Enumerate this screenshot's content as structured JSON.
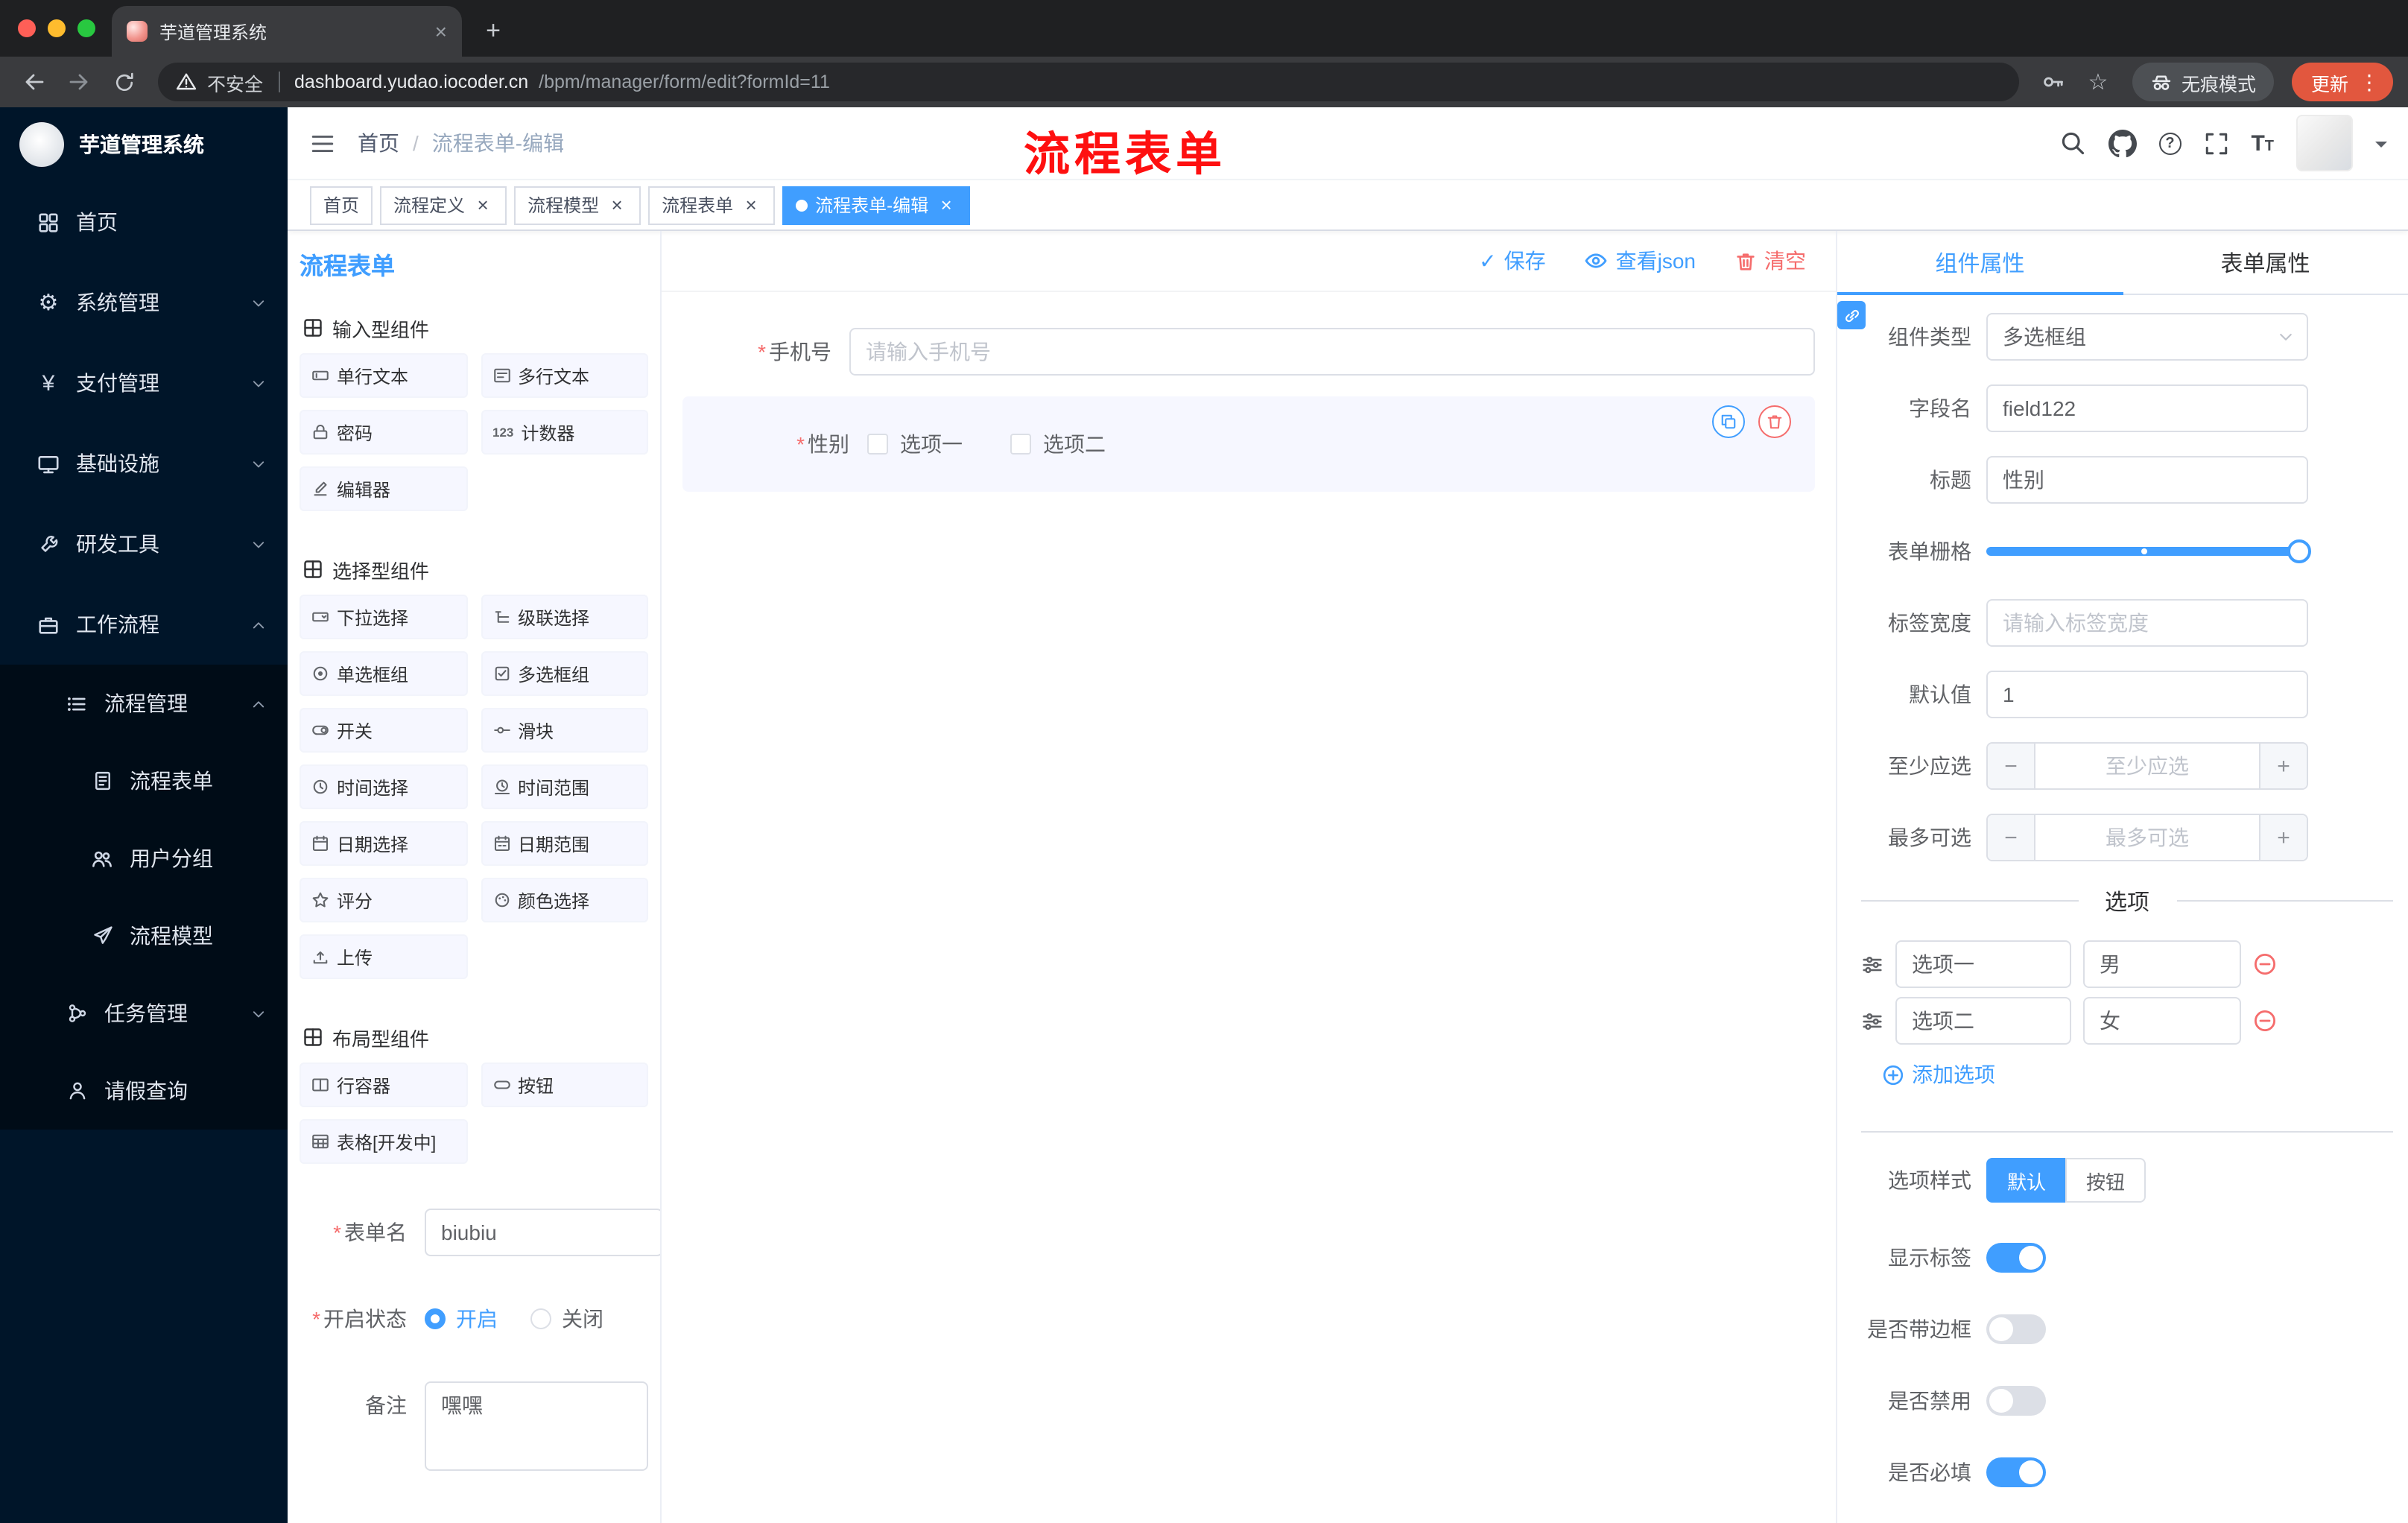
{
  "browser": {
    "tab_title": "芋道管理系统",
    "security_label": "不安全",
    "url_host": "dashboard.yudao.iocoder.cn",
    "url_path": "/bpm/manager/form/edit?formId=11",
    "incognito_label": "无痕模式",
    "update_label": "更新"
  },
  "sidebar": {
    "logo_title": "芋道管理系统",
    "home": "首页",
    "system": "系统管理",
    "payment": "支付管理",
    "infra": "基础设施",
    "devtools": "研发工具",
    "workflow": "工作流程",
    "process_mgmt": "流程管理",
    "process_form": "流程表单",
    "user_group": "用户分组",
    "process_model": "流程模型",
    "task_mgmt": "任务管理",
    "leave_query": "请假查询"
  },
  "header": {
    "breadcrumb_home": "首页",
    "breadcrumb_current": "流程表单-编辑",
    "annotation": "流程表单"
  },
  "tags": {
    "home": "首页",
    "def": "流程定义",
    "model": "流程模型",
    "form": "流程表单",
    "edit": "流程表单-编辑"
  },
  "designer": {
    "panel_title": "流程表单",
    "toolbar": {
      "save": "保存",
      "view_json": "查看json",
      "clear": "清空"
    },
    "groups": {
      "input": {
        "title": "输入型组件",
        "items": [
          "单行文本",
          "多行文本",
          "密码",
          "计数器",
          "编辑器"
        ]
      },
      "select": {
        "title": "选择型组件",
        "items": [
          "下拉选择",
          "级联选择",
          "单选框组",
          "多选框组",
          "开关",
          "滑块",
          "时间选择",
          "时间范围",
          "日期选择",
          "日期范围",
          "评分",
          "颜色选择",
          "上传"
        ]
      },
      "layout": {
        "title": "布局型组件",
        "items": [
          "行容器",
          "按钮",
          "表格[开发中]"
        ]
      }
    },
    "meta": {
      "name_label": "表单名",
      "name_value": "biubiu",
      "status_label": "开启状态",
      "status_on": "开启",
      "status_off": "关闭",
      "remark_label": "备注",
      "remark_value": "嘿嘿"
    },
    "canvas": {
      "phone_label": "手机号",
      "phone_placeholder": "请输入手机号",
      "gender_label": "性别",
      "option1": "选项一",
      "option2": "选项二"
    }
  },
  "props": {
    "tab_component": "组件属性",
    "tab_form": "表单属性",
    "type_label": "组件类型",
    "type_value": "多选框组",
    "field_label": "字段名",
    "field_value": "field122",
    "title_label": "标题",
    "title_value": "性别",
    "grid_label": "表单栅格",
    "width_label": "标签宽度",
    "width_placeholder": "请输入标签宽度",
    "default_label": "默认值",
    "default_value": "1",
    "min_label": "至少应选",
    "min_placeholder": "至少应选",
    "max_label": "最多可选",
    "max_placeholder": "最多可选",
    "options_title": "选项",
    "option1_label": "选项一",
    "option1_value": "男",
    "option2_label": "选项二",
    "option2_value": "女",
    "add_option": "添加选项",
    "style_label": "选项样式",
    "style_default": "默认",
    "style_button": "按钮",
    "show_label": "显示标签",
    "border_label": "是否带边框",
    "disabled_label": "是否禁用",
    "required_label": "是否必填"
  },
  "icons": {
    "close": "×",
    "plus": "+",
    "minus": "−",
    "check": "✓",
    "dots": "⋮",
    "slash": "/",
    "required": "*",
    "gear": "⚙",
    "yen": "¥",
    "star": "☆",
    "question": "?",
    "font_large": "T",
    "font_small": "T",
    "counter": "123"
  },
  "colors": {
    "accent": "#409eff",
    "danger": "#f56c6c",
    "sidebar_bg": "#001529",
    "annotation_red": "#fe1010",
    "update_button": "#e2573e",
    "selected_bg": "#f6f7ff"
  }
}
